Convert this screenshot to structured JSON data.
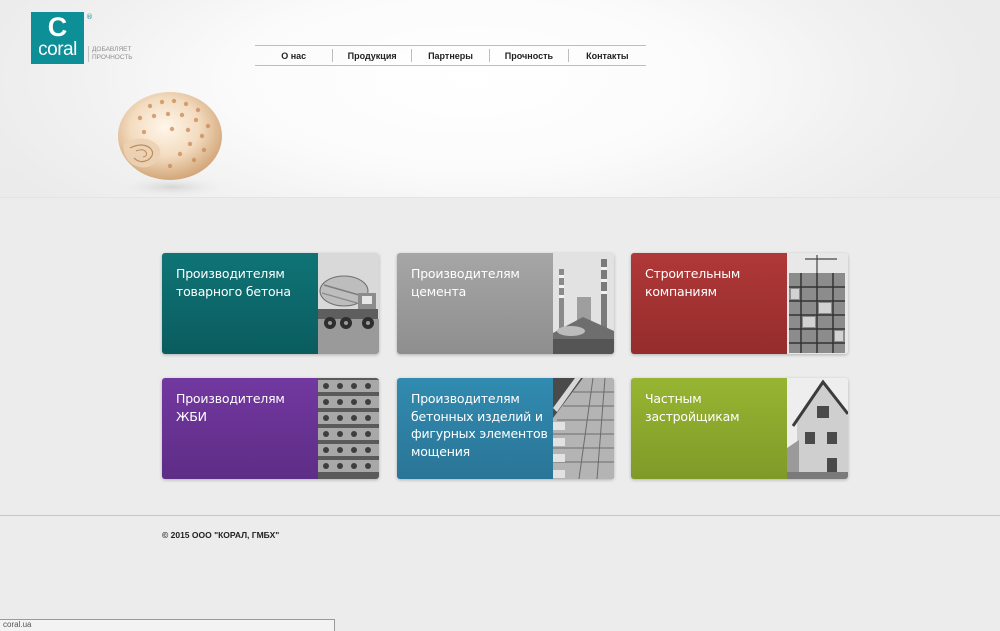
{
  "brand": {
    "logo_letter": "C",
    "logo_word": "coral",
    "registered": "®",
    "tagline_line1": "ДОБАВЛЯЕТ",
    "tagline_line2": "ПРОЧНОСТЬ",
    "color": "#0d8f98"
  },
  "nav": {
    "items": [
      {
        "label": "О нас"
      },
      {
        "label": "Продукция"
      },
      {
        "label": "Партнеры"
      },
      {
        "label": "Прочность"
      },
      {
        "label": "Контакты"
      }
    ]
  },
  "tiles": [
    {
      "lines": [
        "Производителям",
        "товарного бетона"
      ],
      "color": "#0c6a6c",
      "photo": "concrete-mixer-truck"
    },
    {
      "lines": [
        "Производителям",
        "цемента"
      ],
      "color": "#9a9a9a",
      "photo": "cement-plant-chimneys"
    },
    {
      "lines": [
        "Строительным",
        "компаниям"
      ],
      "color": "#a43434",
      "photo": "building-construction"
    },
    {
      "lines": [
        "Производителям",
        "ЖБИ"
      ],
      "color": "#6c3591",
      "photo": "concrete-slabs"
    },
    {
      "lines": [
        "Производителям",
        "бетонных изделий и",
        "фигурных элементов",
        "мощения"
      ],
      "color": "#2e84a8",
      "photo": "paving-stones"
    },
    {
      "lines": [
        "Частным",
        "застройщикам"
      ],
      "color": "#8dac2d",
      "photo": "private-house"
    }
  ],
  "footer": {
    "copyright": "© 2015 ООО \"КОРАЛ, ГМБХ\""
  },
  "statusbar": {
    "text": "coral.ua"
  }
}
